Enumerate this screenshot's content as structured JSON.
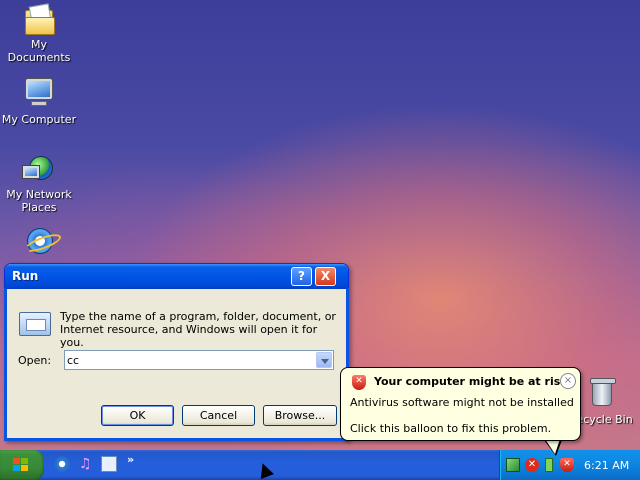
{
  "desktop": {
    "icons": [
      {
        "label": "My Documents"
      },
      {
        "label": "My Computer"
      },
      {
        "label": "My Network Places"
      },
      {
        "label": ""
      },
      {
        "label": "Recycle Bin"
      }
    ]
  },
  "run_dialog": {
    "title": "Run",
    "help_button": "?",
    "close_button": "X",
    "description": "Type the name of a program, folder, document, or Internet resource, and Windows will open it for you.",
    "open_label": "Open:",
    "open_value": "cc",
    "buttons": {
      "ok": "OK",
      "cancel": "Cancel",
      "browse": "Browse..."
    }
  },
  "balloon": {
    "title": "Your computer might be at risk",
    "line1": "Antivirus software might not be installed",
    "line2": "Click this balloon to fix this problem.",
    "close": "×"
  },
  "taskbar": {
    "quick_launch_more": "»",
    "clock": "6:21 AM",
    "icons": [
      "internet-explorer-icon",
      "media-player-icon",
      "show-desktop-icon"
    ],
    "tray_icons": [
      "network-icon",
      "error-icon",
      "usb-icon",
      "security-center-icon"
    ]
  },
  "colors": {
    "title_bar": "#0055e5",
    "dialog_bg": "#ece9d8",
    "taskbar": "#245edb",
    "start_button": "#378a37",
    "tray": "#0f8be6",
    "balloon_bg": "#ffffe1"
  }
}
